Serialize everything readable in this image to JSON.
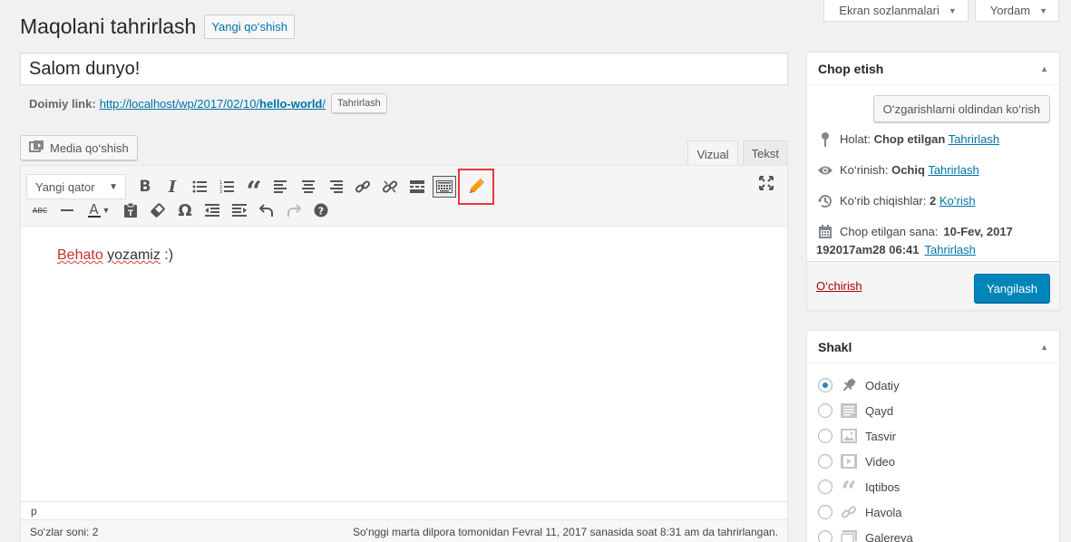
{
  "screen_meta": {
    "screen_options": "Ekran sozlanmalari",
    "help": "Yordam"
  },
  "header": {
    "title": "Maqolani tahrirlash",
    "add_new": "Yangi qo‘shish"
  },
  "post": {
    "title": "Salom dunyo!"
  },
  "permalink": {
    "label": "Doimiy link:",
    "url_base": "http://localhost/wp/2017/02/10/",
    "slug": "hello-world",
    "url_end": "/",
    "edit": "Tahrirlash"
  },
  "media": {
    "label": "Media qo‘shish"
  },
  "editor_tabs": {
    "visual": "Vizual",
    "text": "Tekst"
  },
  "toolbar": {
    "format_select": "Yangi qator",
    "icons_row1": [
      "bold-icon",
      "italic-icon",
      "bulleted-list-icon",
      "numbered-list-icon",
      "blockquote-icon",
      "align-left-icon",
      "align-center-icon",
      "align-right-icon",
      "insert-link-icon",
      "remove-link-icon",
      "read-more-icon",
      "toolbar-toggle-icon",
      "pencil-icon",
      "fullscreen-icon"
    ],
    "icons_row2": [
      "strikethrough-icon",
      "horizontal-line-icon",
      "text-color-icon",
      "paste-as-text-icon",
      "clear-formatting-icon",
      "special-character-icon",
      "outdent-icon",
      "indent-icon",
      "undo-icon",
      "redo-icon",
      "help-icon"
    ]
  },
  "content": {
    "word1": "Behato",
    "word2": "yozamiz",
    "rest": " :)"
  },
  "status": {
    "path": "p",
    "word_count": "So‘zlar soni: 2",
    "last_edited": "So'nggi marta dilpora tomonidan Fevral 11, 2017 sanasida soat 8:31 am da tahrirlangan."
  },
  "publish": {
    "title": "Chop etish",
    "preview": "O‘zgarishlarni oldindan ko‘rish",
    "status_label": "Holat:",
    "status_value": "Chop etilgan",
    "status_edit": "Tahrirlash",
    "visibility_label": "Ko‘rinish:",
    "visibility_value": "Ochiq",
    "visibility_edit": "Tahrirlash",
    "revisions_label": "Ko‘rib chiqishlar:",
    "revisions_count": "2",
    "revisions_link": "Ko‘rish",
    "date_label": "Chop etilgan sana:",
    "date_value": "10-Fev, 2017",
    "date_value2": "192017am28 06:41",
    "date_edit": "Tahrirlash",
    "delete": "O‘chirish",
    "update": "Yangilash"
  },
  "format": {
    "title": "Shakl",
    "items": [
      {
        "label": "Odatiy",
        "icon": "pin-icon",
        "checked": true
      },
      {
        "label": "Qayd",
        "icon": "aside-icon",
        "checked": false
      },
      {
        "label": "Tasvir",
        "icon": "image-icon",
        "checked": false
      },
      {
        "label": "Video",
        "icon": "video-icon",
        "checked": false
      },
      {
        "label": "Iqtibos",
        "icon": "quote-icon",
        "checked": false
      },
      {
        "label": "Havola",
        "icon": "link-icon",
        "checked": false
      },
      {
        "label": "Galereya",
        "icon": "gallery-icon",
        "checked": false
      }
    ]
  },
  "colors": {
    "accent": "#0073aa",
    "primary_button": "#0085ba",
    "highlight_outline": "#e8383d",
    "delete": "#a00000",
    "misspelled": "#c9302c"
  }
}
